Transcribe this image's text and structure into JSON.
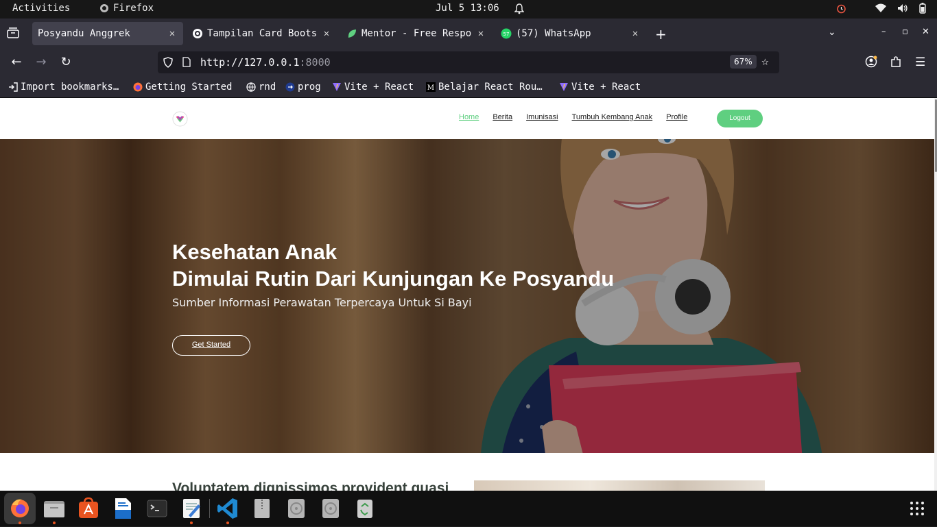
{
  "system": {
    "activities": "Activities",
    "app_name": "Firefox",
    "clock": "Jul 5 13:06"
  },
  "tabs": [
    {
      "title": "Posyandu Anggrek",
      "active": true
    },
    {
      "title": "Tampilan Card Boots",
      "active": false
    },
    {
      "title": "Mentor - Free Respo",
      "active": false
    },
    {
      "title": "(57) WhatsApp",
      "active": false
    }
  ],
  "toolbar": {
    "url_host": "http://127.0.0.1",
    "url_port": ":8000",
    "zoom": "67%"
  },
  "bookmarks": [
    {
      "label": "Import bookmarks…",
      "icon": "import-icon"
    },
    {
      "label": "Getting Started",
      "icon": "firefox-icon"
    },
    {
      "label": "rnd",
      "icon": "globe-icon"
    },
    {
      "label": "prog",
      "icon": "arrow-icon"
    },
    {
      "label": "Vite + React",
      "icon": "vite-icon"
    },
    {
      "label": "Belajar React Rou…",
      "icon": "medium-icon"
    },
    {
      "label": "Vite + React",
      "icon": "vite-icon"
    }
  ],
  "site": {
    "nav": [
      {
        "label": "Home",
        "current": true
      },
      {
        "label": "Berita",
        "current": false
      },
      {
        "label": "Imunisasi",
        "current": false
      },
      {
        "label": "Tumbuh Kembang Anak",
        "current": false
      },
      {
        "label": "Profile",
        "current": false
      }
    ],
    "logout": "Logout",
    "hero": {
      "line1": "Kesehatan Anak",
      "line2": "Dimulai Rutin Dari Kunjungan Ke Posyandu",
      "subtitle": "Sumber Informasi Perawatan Terpercaya Untuk Si Bayi",
      "cta": "Get Started"
    },
    "section_title": "Voluptatem dignissimos provident quasi",
    "accent_color": "#5fcf80"
  },
  "dock": [
    "firefox",
    "files",
    "app-center",
    "libreoffice-writer",
    "terminal",
    "text-editor",
    "vscode",
    "archive",
    "disk-1",
    "disk-2",
    "trash"
  ]
}
